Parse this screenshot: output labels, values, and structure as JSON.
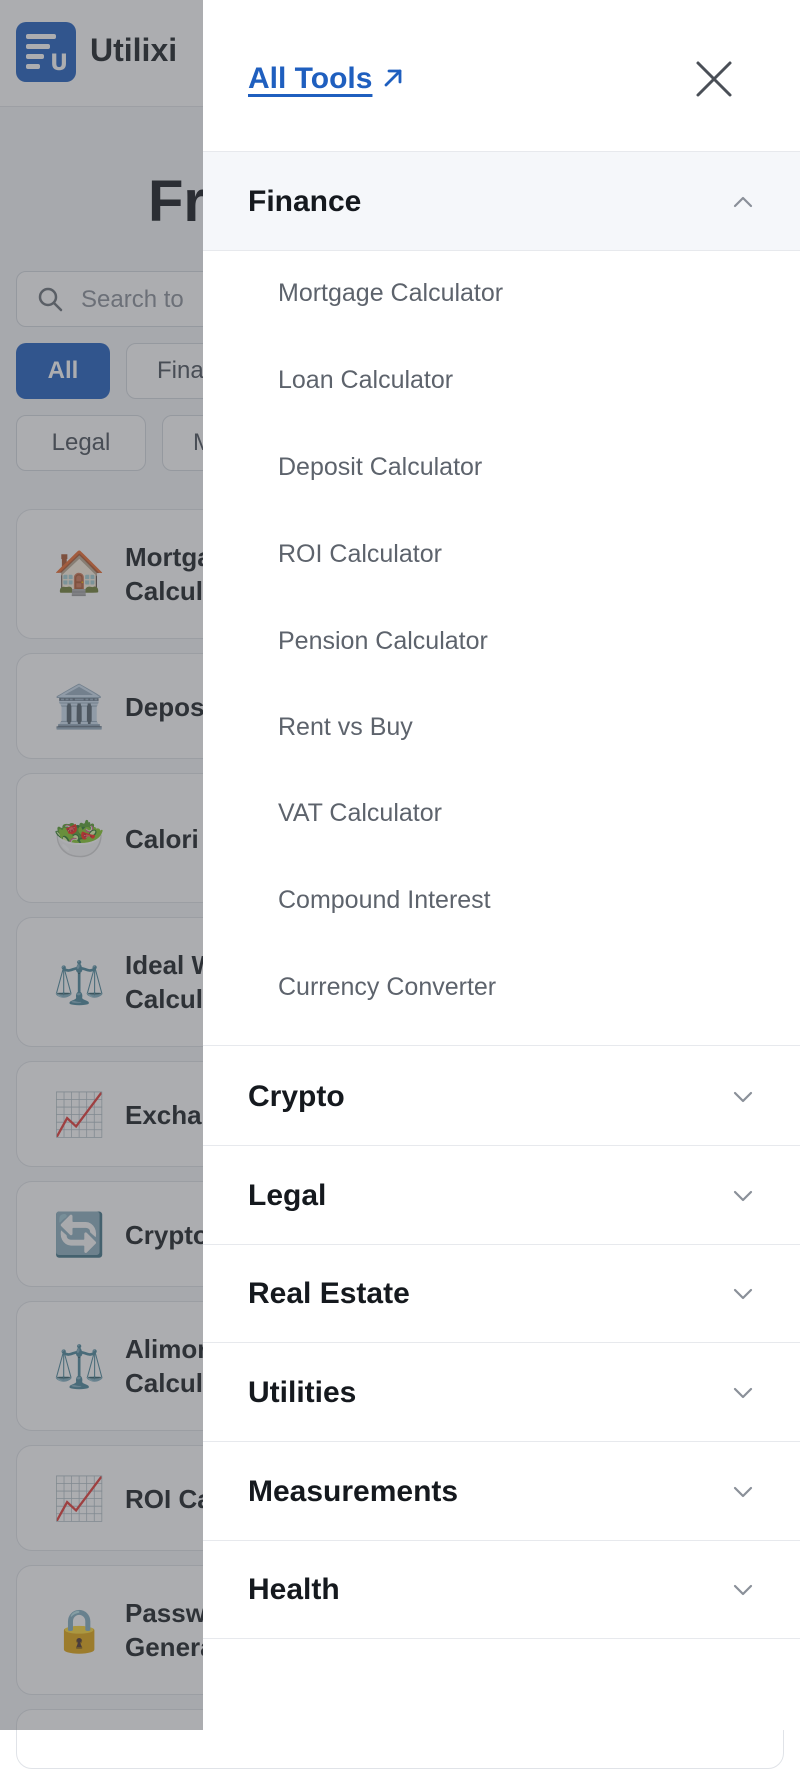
{
  "background": {
    "brand": "Utilixi",
    "page_title": "Fr",
    "search_placeholder": "Search to",
    "chips": [
      "All",
      "Fina",
      "Legal",
      "M"
    ],
    "cards": [
      {
        "emoji": "🏠",
        "title": "Mortga\nCalcul"
      },
      {
        "emoji": "🏛️",
        "title": "Depos"
      },
      {
        "emoji": "🥗",
        "title": "Calori"
      },
      {
        "emoji": "⚖️",
        "title": "Ideal W\nCalcul"
      },
      {
        "emoji": "📈",
        "title": "Exchai"
      },
      {
        "emoji": "🔄",
        "title": "Crypto"
      },
      {
        "emoji": "⚖️",
        "title": "Alimor\nCalcul"
      },
      {
        "emoji": "📈",
        "title": "ROI Ca"
      },
      {
        "emoji": "🔒",
        "title": "Passw\nGenera"
      }
    ]
  },
  "drawer": {
    "all_tools_label": "All Tools",
    "sections": [
      {
        "label": "Finance",
        "expanded": true,
        "items": [
          "Mortgage Calculator",
          "Loan Calculator",
          "Deposit Calculator",
          "ROI Calculator",
          "Pension Calculator",
          "Rent vs Buy",
          "VAT Calculator",
          "Compound Interest",
          "Currency Converter"
        ]
      },
      {
        "label": "Crypto",
        "expanded": false
      },
      {
        "label": "Legal",
        "expanded": false
      },
      {
        "label": "Real Estate",
        "expanded": false
      },
      {
        "label": "Utilities",
        "expanded": false
      },
      {
        "label": "Measurements",
        "expanded": false
      },
      {
        "label": "Health",
        "expanded": false
      }
    ]
  },
  "colors": {
    "accent": "#1f5fbf",
    "overlay": "#464a50",
    "open_section_bg": "#f5f7fa"
  }
}
